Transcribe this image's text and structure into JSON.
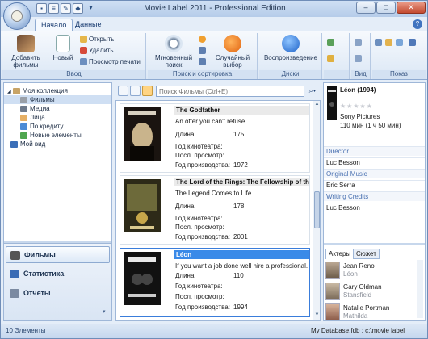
{
  "window": {
    "title": "Movie Label 2011 - Professional Edition",
    "controls": {
      "minimize": "–",
      "maximize": "□",
      "close": "✕"
    }
  },
  "tabs": [
    {
      "label": "Начало",
      "active": true
    },
    {
      "label": "Данные",
      "active": false
    }
  ],
  "ribbon": {
    "groups": [
      {
        "name": "Ввод",
        "add_label": "Добавить фильмы",
        "new_label": "Новый",
        "open_label": "Открыть",
        "delete_label": "Удалить",
        "preview_label": "Просмотр печати"
      },
      {
        "name": "Поиск и сортировка",
        "quicksearch_label": "Мгновенный поиск",
        "random_label": "Случайный выбор"
      },
      {
        "name": "Диски",
        "play_label": "Воспроизведение"
      },
      {
        "name": "Вид"
      },
      {
        "name": "Показ"
      }
    ]
  },
  "nav": {
    "tree": [
      {
        "label": "Моя коллекция",
        "level": 0,
        "icon": "collection-icon"
      },
      {
        "label": "Фильмы",
        "level": 1,
        "icon": "film-icon",
        "selected": true
      },
      {
        "label": "Медиа",
        "level": 1,
        "icon": "media-icon"
      },
      {
        "label": "Лица",
        "level": 1,
        "icon": "people-icon"
      },
      {
        "label": "По кредиту",
        "level": 1,
        "icon": "loan-icon"
      },
      {
        "label": "Новые элементы",
        "level": 1,
        "icon": "new-items-icon"
      },
      {
        "label": "Мой вид",
        "level": 0,
        "icon": "myview-icon"
      }
    ],
    "buttons": [
      {
        "label": "Фильмы",
        "selected": true
      },
      {
        "label": "Статистика",
        "selected": false
      },
      {
        "label": "Отчеты",
        "selected": false
      }
    ]
  },
  "search": {
    "placeholder": "Поиск Фильмы (Ctrl+E)"
  },
  "movies": [
    {
      "title": "The Godfather",
      "tagline": "An offer you can't refuse.",
      "length_label": "Длина:",
      "length": "175",
      "year_label": "Год кинотеатра:",
      "last_label": "Посл. просмотр:",
      "prod_label": "Год производства:",
      "prod_year": "1972"
    },
    {
      "title": "The Lord of the Rings: The Fellowship of th...",
      "tagline": "The Legend Comes to Life",
      "length_label": "Длина:",
      "length": "178",
      "year_label": "Год кинотеатра:",
      "last_label": "Посл. просмотр:",
      "prod_label": "Год производства:",
      "prod_year": "2001"
    },
    {
      "title": "Léon",
      "tagline": "If you want a job done well hire a professional.",
      "length_label": "Длина:",
      "length": "110",
      "year_label": "Год кинотеатра:",
      "last_label": "Посл. просмотр:",
      "prod_label": "Год производства:",
      "prod_year": "1994",
      "selected": true
    }
  ],
  "detail": {
    "title": "Léon (1994)",
    "stars": "★★★★★",
    "studio": "Sony Pictures",
    "runtime": "110 мин (1 ч 50 мин)",
    "sections": [
      {
        "heading": "Director",
        "value": "Luc Besson"
      },
      {
        "heading": "Original Music",
        "value": "Eric Serra"
      },
      {
        "heading": "Writing Credits",
        "value": "Luc Besson"
      }
    ],
    "cast_tabs": [
      {
        "label": "Актеры",
        "active": true
      },
      {
        "label": "Сюжет",
        "active": false
      }
    ],
    "cast": [
      {
        "name": "Jean Reno",
        "role": "Léon"
      },
      {
        "name": "Gary Oldman",
        "role": "Stansfield"
      },
      {
        "name": "Natalie Portman",
        "role": "Mathilda"
      }
    ]
  },
  "status": {
    "count": "10 Элементы",
    "database": "My Database.fdb : c:\\movie label"
  },
  "colors": {
    "accent": "#3a8ae8",
    "ribbon": "#dbe7f5",
    "link": "#4a71b1"
  }
}
